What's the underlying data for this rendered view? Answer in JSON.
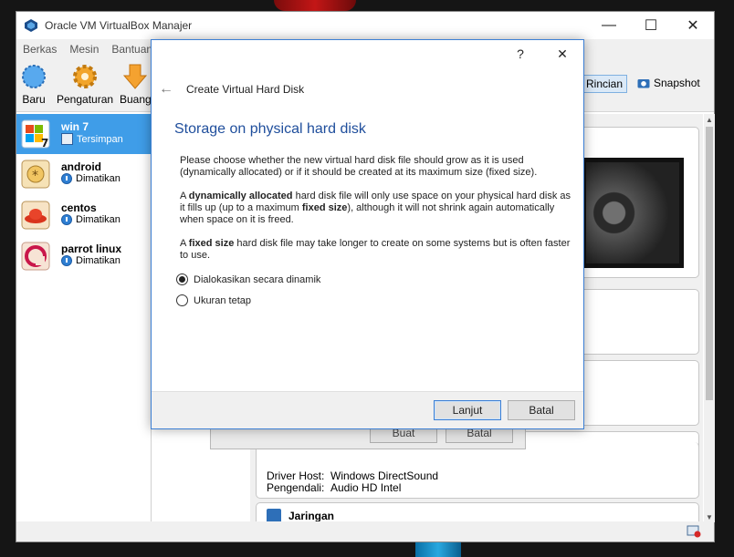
{
  "window": {
    "title": "Oracle VM VirtualBox Manajer",
    "controls": [
      "—",
      "☐",
      "✕"
    ]
  },
  "menu": [
    "Berkas",
    "Mesin",
    "Bantuan"
  ],
  "toolbar": {
    "new_label": "Baru",
    "settings_label": "Pengaturan",
    "discard_label": "Buang",
    "details_label": "Rincian",
    "snapshot_label": "Snapshot"
  },
  "vms": [
    {
      "name": "win 7",
      "state": "Tersimpan"
    },
    {
      "name": "android",
      "state": "Dimatikan"
    },
    {
      "name": "centos",
      "state": "Dimatikan"
    },
    {
      "name": "parrot linux",
      "state": "Dimatikan"
    }
  ],
  "details": {
    "audio": {
      "driver_key": "Driver Host:",
      "driver_val": "Windows DirectSound",
      "ctrl_key": "Pengendali:",
      "ctrl_val": "Audio HD Intel"
    },
    "network_title": "Jaringan"
  },
  "ghost": {
    "create": "Buat",
    "cancel": "Batal"
  },
  "dialog": {
    "help": "?",
    "close": "✕",
    "back": "←",
    "title": "Create Virtual Hard Disk",
    "heading": "Storage on physical hard disk",
    "p1": "Please choose whether the new virtual hard disk file should grow as it is used (dynamically allocated) or if it should be created at its maximum size (fixed size).",
    "p2_a": "A ",
    "p2_b": "dynamically allocated",
    "p2_c": " hard disk file will only use space on your physical hard disk as it fills up (up to a maximum ",
    "p2_d": "fixed size",
    "p2_e": "), although it will not shrink again automatically when space on it is freed.",
    "p3_a": "A ",
    "p3_b": "fixed size",
    "p3_c": " hard disk file may take longer to create on some systems but is often faster to use.",
    "option_dynamic": "Dialokasikan secara dinamik",
    "option_fixed": "Ukuran tetap",
    "next": "Lanjut",
    "cancel": "Batal"
  },
  "colors": {
    "accent": "#3f9de8",
    "heading": "#1f4e9c"
  }
}
